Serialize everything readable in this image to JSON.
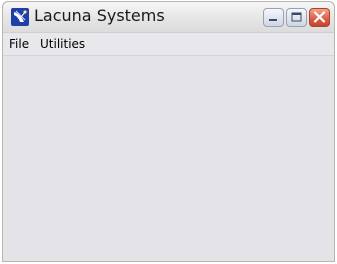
{
  "window": {
    "title": "Lacuna Systems",
    "app_icon": "satellite-dish-icon",
    "controls": [
      "minimize-icon",
      "maximize-icon",
      "close-icon"
    ]
  },
  "menu": {
    "items": [
      {
        "label": "File"
      },
      {
        "label": "Utilities"
      }
    ]
  },
  "colors": {
    "titlebar": "#e8e8e8",
    "client_background": "#e3e3e8",
    "close_button": "#d75d44",
    "app_icon_background": "#1f3fa8"
  }
}
